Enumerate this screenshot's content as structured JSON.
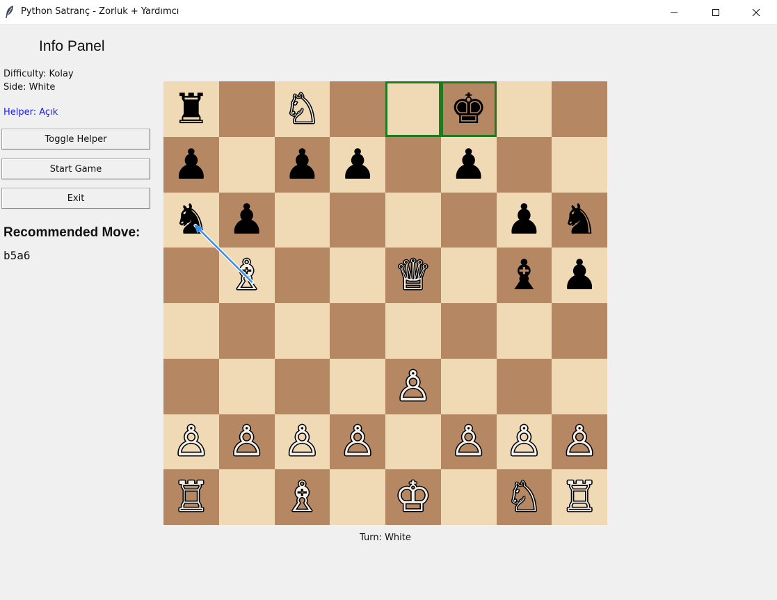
{
  "window": {
    "title": "Python Satranç - Zorluk + Yardımcı",
    "icon": "feather-icon"
  },
  "panel": {
    "title": "Info Panel",
    "difficulty": "Difficulty: Kolay",
    "side": "Side: White",
    "helper": "Helper: Açık",
    "helper_color": "#1a1ae6",
    "buttons": {
      "toggle_helper": "Toggle Helper",
      "start_game": "Start Game",
      "exit": "Exit"
    },
    "recommended_title": "Recommended Move:",
    "recommended_value": "b5a6"
  },
  "board": {
    "light_color": "#f0d9b5",
    "dark_color": "#b58863",
    "highlight_color": "#1f7a1f",
    "arrow_color": "#3a8ee6",
    "highlighted_squares": [
      "e8",
      "f8"
    ],
    "arrow": {
      "from": "b5",
      "to": "a6"
    },
    "ranks": [
      [
        "r",
        "",
        "N",
        "",
        "",
        "k",
        "",
        ""
      ],
      [
        "p",
        "",
        "p",
        "p",
        "",
        "p",
        "",
        ""
      ],
      [
        "n",
        "p",
        "",
        "",
        "",
        "",
        "p",
        "n"
      ],
      [
        "",
        "B",
        "",
        "",
        "Q",
        "",
        "b",
        "p"
      ],
      [
        "",
        "",
        "",
        "",
        "",
        "",
        "",
        ""
      ],
      [
        "",
        "",
        "",
        "",
        "P",
        "",
        "",
        ""
      ],
      [
        "P",
        "P",
        "P",
        "P",
        "",
        "P",
        "P",
        "P"
      ],
      [
        "R",
        "",
        "B",
        "",
        "K",
        "",
        "N",
        "R"
      ]
    ]
  },
  "status": {
    "turn": "Turn: White"
  }
}
